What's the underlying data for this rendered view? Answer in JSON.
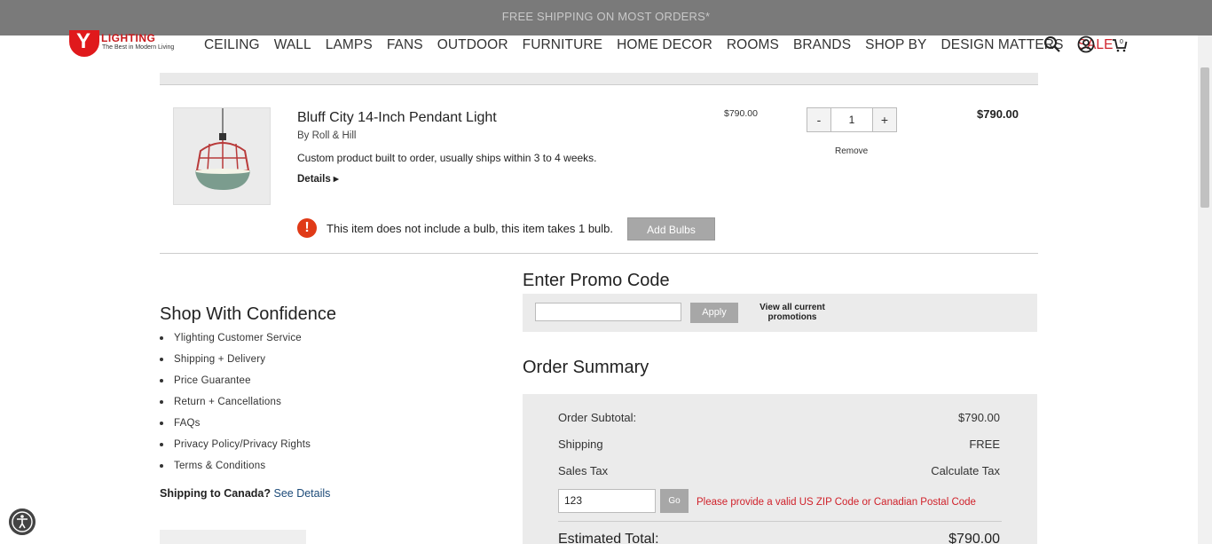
{
  "banner": {
    "text": "FREE SHIPPING ON MOST ORDERS*"
  },
  "brand": {
    "wordmark": "LIGHTING",
    "tagline": "The Best in Modern Living",
    "logo_letter": "Y",
    "accent": "#e0191c"
  },
  "nav": {
    "items": [
      "CEILING",
      "WALL",
      "LAMPS",
      "FANS",
      "OUTDOOR",
      "FURNITURE",
      "HOME DECOR",
      "ROOMS",
      "BRANDS",
      "SHOP BY",
      "DESIGN MATTERS",
      "SALE"
    ],
    "sale_color": "#d0212a"
  },
  "header_icons": [
    "search-icon",
    "account-icon",
    "cart-icon"
  ],
  "item": {
    "title": "Bluff City 14-Inch Pendant Light",
    "brand_prefix": "By ",
    "brand": "Roll & Hill",
    "note": "Custom product built to order, usually ships within 3 to 4 weeks.",
    "details_label": "Details ▸",
    "unit_price": "$790.00",
    "qty_minus": "-",
    "qty_value": "1",
    "qty_plus": "+",
    "remove_label": "Remove",
    "subtotal": "$790.00",
    "bulb_warning": "This item does not include a bulb, this item takes 1 bulb.",
    "add_bulbs_label": "Add Bulbs"
  },
  "promo": {
    "title": "Enter Promo Code",
    "input_value": "",
    "apply_label": "Apply",
    "view_link": "View all current promotions"
  },
  "confidence": {
    "title": "Shop With Confidence",
    "links": [
      "Ylighting Customer Service",
      "Shipping + Delivery",
      "Price Guarantee",
      "Return + Cancellations",
      "FAQs",
      "Privacy Policy/Privacy Rights",
      "Terms & Conditions"
    ],
    "canada_label": "Shipping to Canada?",
    "canada_link": "See Details"
  },
  "summary": {
    "title": "Order Summary",
    "subtotal_label": "Order Subtotal:",
    "subtotal_value": "$790.00",
    "shipping_label": "Shipping",
    "shipping_value": "FREE",
    "tax_label": "Sales Tax",
    "tax_value": "Calculate Tax",
    "zip_value": "123",
    "go_label": "Go",
    "zip_error": "Please provide a valid US ZIP Code or Canadian Postal Code",
    "total_label": "Estimated Total:",
    "total_value": "$790.00"
  }
}
